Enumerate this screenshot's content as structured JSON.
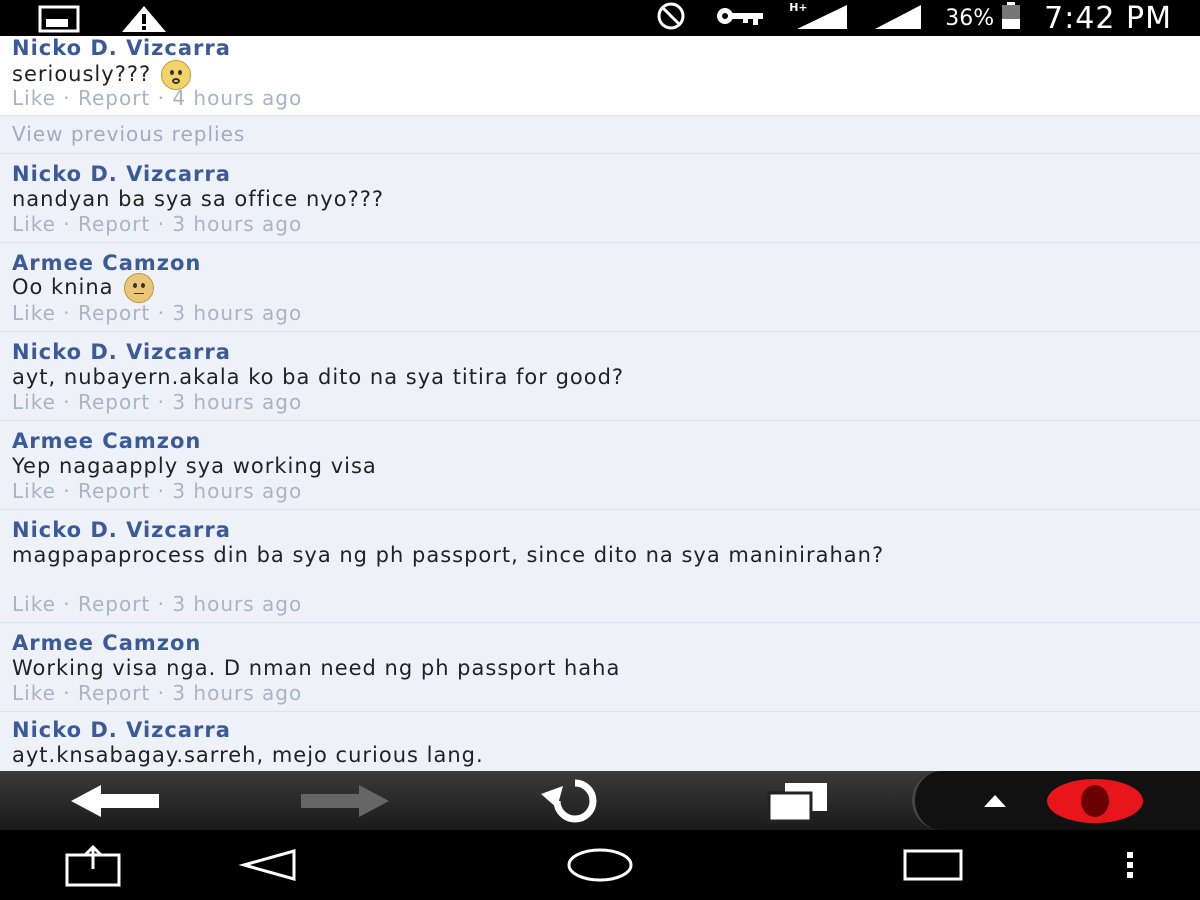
{
  "status_bar": {
    "left_icons": [
      "image-icon",
      "warning-icon"
    ],
    "right_icons": [
      "no-sign-icon",
      "key-icon",
      "signal-hplus-icon",
      "signal-icon",
      "battery-icon"
    ],
    "network_type": "H+",
    "battery": "36%",
    "time": "7:42 PM"
  },
  "thread": {
    "view_previous": "View previous replies",
    "comments": [
      {
        "author": "Nicko D. Vizcarra",
        "text": "seriously???",
        "emoji": "surprised-emoji-icon",
        "like": "Like",
        "report": "Report",
        "time": "4 hours ago"
      },
      {
        "author": "Nicko D. Vizcarra",
        "text": "nandyan ba sya sa office nyo???",
        "like": "Like",
        "report": "Report",
        "time": "3 hours ago"
      },
      {
        "author": "Armee Camzon",
        "text": "Oo knina",
        "emoji": "unsure-emoji-icon",
        "like": "Like",
        "report": "Report",
        "time": "3 hours ago"
      },
      {
        "author": "Nicko D. Vizcarra",
        "text": "ayt, nubayern.akala ko ba dito na sya titira for good?",
        "like": "Like",
        "report": "Report",
        "time": "3 hours ago"
      },
      {
        "author": "Armee Camzon",
        "text": "Yep nagaapply sya working visa",
        "like": "Like",
        "report": "Report",
        "time": "3 hours ago"
      },
      {
        "author": "Nicko D. Vizcarra",
        "text": "magpapaprocess din ba sya ng ph passport, since dito na sya maninirahan?",
        "like": "Like",
        "report": "Report",
        "time": "3 hours ago"
      },
      {
        "author": "Armee Camzon",
        "text": "Working visa nga. D nman need ng ph passport haha",
        "like": "Like",
        "report": "Report",
        "time": "3 hours ago"
      },
      {
        "author": "Nicko D. Vizcarra",
        "text": "ayt.knsabagay.sarreh, mejo curious lang."
      }
    ],
    "separator": " · "
  },
  "browser_toolbar": {
    "buttons": [
      "back-arrow-icon",
      "forward-arrow-icon",
      "reload-icon",
      "tabs-icon",
      "chevron-up-icon",
      "opera-logo-icon"
    ],
    "colors": {
      "opera_red": "#e8151b"
    }
  },
  "nav_bar": {
    "buttons": [
      "share-icon",
      "back-triangle-icon",
      "home-circle-icon",
      "recents-square-icon",
      "overflow-menu-icon"
    ]
  },
  "colors": {
    "author": "#3b5a98",
    "meta": "#a9b3c7",
    "background": "#eef2f8"
  }
}
